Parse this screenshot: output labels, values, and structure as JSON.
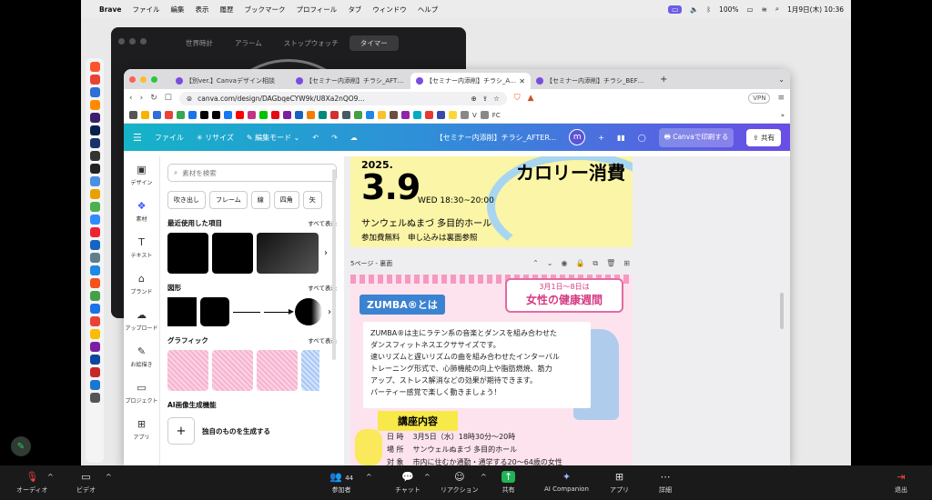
{
  "menubar": {
    "app": "Brave",
    "items": [
      "ファイル",
      "編集",
      "表示",
      "履歴",
      "ブックマーク",
      "プロフィール",
      "タブ",
      "ウィンドウ",
      "ヘルプ"
    ],
    "battery": "100%",
    "datetime": "1月9日(木) 10:36"
  },
  "timer_window": {
    "tabs": [
      "世界時計",
      "アラーム",
      "ストップウォッチ",
      "タイマー"
    ]
  },
  "browser": {
    "tabs": [
      {
        "title": "【別ver.】Canvaデザイン相談",
        "active": false
      },
      {
        "title": "【セミナー内添削】チラシ_AFTER",
        "active": false
      },
      {
        "title": "【セミナー内添削】チラシ_AFTER",
        "active": true
      },
      {
        "title": "【セミナー内添削】チラシ_BEFORE",
        "active": false
      }
    ],
    "url": "canva.com/design/DAGbqeCYW9k/U8Xa2nQO9...",
    "vpn": "VPN",
    "bookmark_folders": [
      "V",
      "FC"
    ]
  },
  "canva": {
    "file": "ファイル",
    "resize": "リサイズ",
    "edit_mode": "編集モード",
    "doc_title": "【セミナー内添削】チラシ_AFTER...",
    "avatar_initial": "m",
    "print": "Canvaで印刷する",
    "share": "共有"
  },
  "rail": [
    {
      "label": "デザイン",
      "icon": "layout-icon"
    },
    {
      "label": "素材",
      "icon": "elements-icon"
    },
    {
      "label": "テキスト",
      "icon": "text-icon"
    },
    {
      "label": "ブランド",
      "icon": "brand-icon"
    },
    {
      "label": "アップロード",
      "icon": "upload-icon"
    },
    {
      "label": "お絵描き",
      "icon": "draw-icon"
    },
    {
      "label": "プロジェクト",
      "icon": "folder-icon"
    },
    {
      "label": "アプリ",
      "icon": "apps-icon"
    }
  ],
  "panel": {
    "search_placeholder": "素材を検索",
    "chips": [
      "吹き出し",
      "フレーム",
      "線",
      "四角",
      "矢"
    ],
    "recent": "最近使用した項目",
    "shapes": "図形",
    "graphics": "グラフィック",
    "see_all": "すべて表示",
    "ai": "AI画像生成機能",
    "generate": "独自のものを生成する"
  },
  "page1": {
    "year": "2025.",
    "date": "3.9",
    "weekday_time": "WED 18:30~20:00",
    "hall": "サンウェルぬまづ 多目的ホール",
    "fee": "参加費無料　申し込みは裏面参照",
    "headline": "カロリー消費"
  },
  "page2": {
    "label": "5ページ - 裏面",
    "zumba_title": "ZUMBA®とは",
    "week_small": "3月1日～8日は",
    "week_big": "女性の健康週間",
    "body": [
      "ZUMBA®は主にラテン系の音楽とダンスを組み合わせた",
      "ダンスフィットネスエクササイズです。",
      "速いリズムと遅いリズムの曲を組み合わせたインターバル",
      "トレーニング形式で、心肺機能の向上や脂肪燃焼、筋力",
      "アップ、ストレス解消などの効果が期待できます。",
      "パーティー感覚で楽しく動きましょう！"
    ],
    "course": "講座内容",
    "info": [
      {
        "k": "日 時",
        "v": "3月5日（水）18時30分～20時"
      },
      {
        "k": "場 所",
        "v": "サンウェルぬまづ 多目的ホール"
      },
      {
        "k": "対 象",
        "v": "市内に住むか通勤・通学する20～64歳の女性"
      }
    ]
  },
  "zoom": {
    "audio": "オーディオ",
    "video": "ビデオ",
    "participants": "参加者",
    "participant_count": "44",
    "chat": "チャット",
    "reaction": "リアクション",
    "share": "共有",
    "ai": "AI Companion",
    "apps": "アプリ",
    "more": "詳細",
    "leave": "退出"
  }
}
